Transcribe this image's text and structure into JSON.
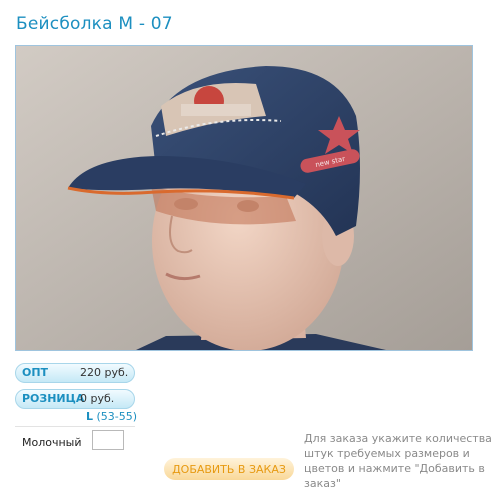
{
  "product": {
    "title": "Бейсболка М - 07"
  },
  "prices": {
    "wholesale": {
      "label": "ОПТ",
      "value": "220 руб."
    },
    "retail": {
      "label": "РОЗНИЦА",
      "value": "0 руб."
    }
  },
  "size": {
    "label": "L",
    "range": "(53-55)"
  },
  "order": {
    "color_label": "Молочный",
    "quantity": "",
    "add_button_label": "ДОБАВИТЬ В ЗАКАЗ",
    "instructions": "Для заказа укажите количества штук требуемых размеров и цветов и нажмите \"Добавить в заказ\""
  },
  "image": {
    "patch_text": "new star"
  },
  "colors": {
    "accent": "#1c8fc0",
    "button_text": "#e79a12",
    "cap": "#2d4063"
  }
}
